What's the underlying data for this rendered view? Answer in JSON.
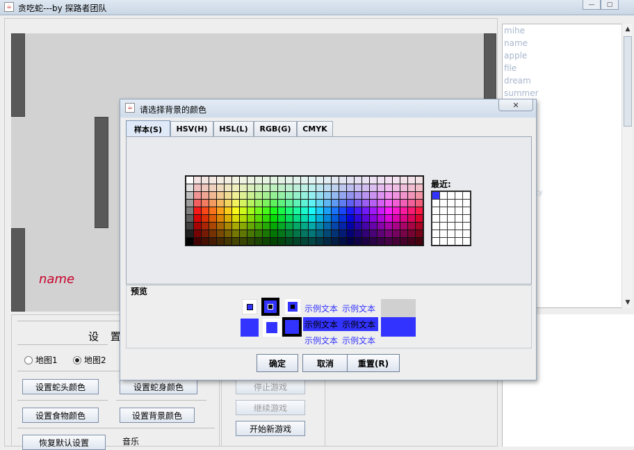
{
  "window": {
    "title": "贪吃蛇---by 探路者团队",
    "minimize_glyph": "—",
    "maximize_glyph": "▢",
    "close_glyph": "✕"
  },
  "game": {
    "snake_name": "name"
  },
  "word_list": {
    "items": [
      "mihe",
      "name",
      "apple",
      "file",
      "dream",
      "summer"
    ],
    "ghost_text": "ty"
  },
  "settings": {
    "heading": "设 置",
    "map1": "地图1",
    "map2": "地图2",
    "selected_map": "地图2",
    "btn_head_color": "设置蛇头颜色",
    "btn_body_color": "设置蛇身颜色",
    "btn_food_color": "设置食物颜色",
    "btn_bg_color": "设置背景颜色",
    "btn_restore": "恢复默认设置",
    "music_label": "音乐"
  },
  "controls": {
    "stop_game": "停止游戏",
    "continue_game": "继续游戏",
    "new_game": "开始新游戏"
  },
  "dialog": {
    "title": "请选择背景的颜色",
    "close_glyph": "✕",
    "tabs": [
      {
        "label": "样本(S)",
        "active": true
      },
      {
        "label": "HSV(H)",
        "active": false
      },
      {
        "label": "HSL(L)",
        "active": false
      },
      {
        "label": "RGB(G)",
        "active": false
      },
      {
        "label": "CMYK",
        "active": false
      }
    ],
    "recent_label": "最近:",
    "recent_selected_color": "#3333ff",
    "preview_label": "预览",
    "sample_text": "示例文本",
    "preview_color": "#3333ff",
    "preview_old_color": "#d0d0d0",
    "ok_button": "确定",
    "cancel_button": "取消",
    "reset_button": "重置(R)"
  },
  "icons": {
    "app_icon": "java-coffee-icon",
    "dialog_icon": "java-coffee-icon"
  }
}
